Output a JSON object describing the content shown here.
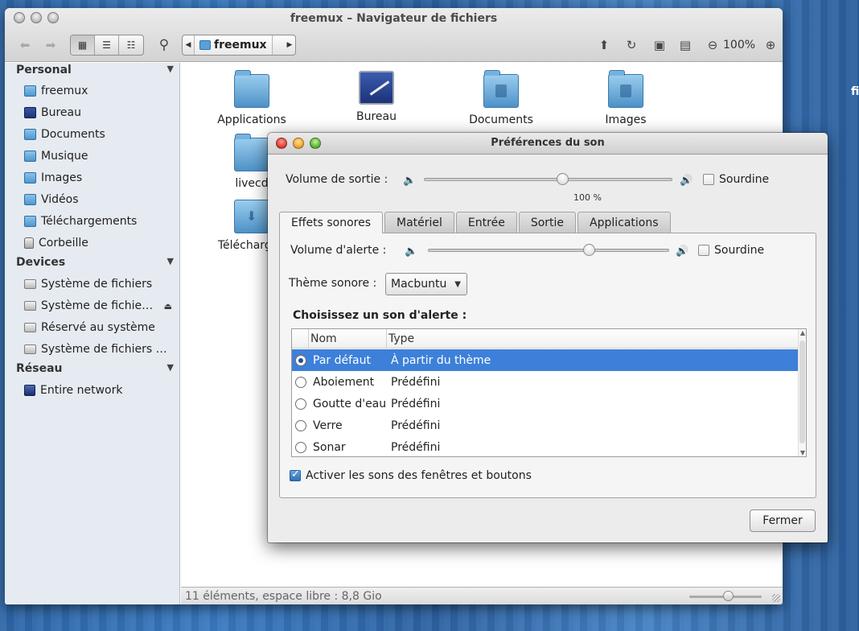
{
  "desktop": {
    "partial_label": "fi"
  },
  "file_manager": {
    "title": "freemux – Navigateur de fichiers",
    "path_crumb": "freemux",
    "zoom_label": "100%",
    "sidebar": {
      "sections": [
        {
          "header": "Personal",
          "items": [
            {
              "label": "freemux",
              "icon": "home-folder-icon"
            },
            {
              "label": "Bureau",
              "icon": "desktop-icon"
            },
            {
              "label": "Documents",
              "icon": "documents-folder-icon"
            },
            {
              "label": "Musique",
              "icon": "music-folder-icon"
            },
            {
              "label": "Images",
              "icon": "pictures-folder-icon"
            },
            {
              "label": "Vidéos",
              "icon": "videos-folder-icon"
            },
            {
              "label": "Téléchargements",
              "icon": "downloads-folder-icon"
            },
            {
              "label": "Corbeille",
              "icon": "trash-icon"
            }
          ]
        },
        {
          "header": "Devices",
          "items": [
            {
              "label": "Système de fichiers",
              "icon": "drive-icon"
            },
            {
              "label": "Système de fichie…",
              "icon": "drive-icon"
            },
            {
              "label": "Réservé au système",
              "icon": "drive-icon"
            },
            {
              "label": "Système de fichiers …",
              "icon": "drive-icon"
            }
          ]
        },
        {
          "header": "Réseau",
          "items": [
            {
              "label": "Entire network",
              "icon": "network-icon"
            }
          ]
        }
      ]
    },
    "files": [
      "Applications",
      "Bureau",
      "Documents",
      "Images",
      "livecd",
      "Téléchargen"
    ],
    "status": "11 éléments, espace libre : 8,8 Gio"
  },
  "dialog": {
    "title": "Préférences du son",
    "output_volume_label": "Volume de sortie :",
    "output_volume_percent": "100 %",
    "output_volume_level": 0.56,
    "mute_label": "Sourdine",
    "tabs": [
      "Effets sonores",
      "Matériel",
      "Entrée",
      "Sortie",
      "Applications"
    ],
    "active_tab": "Effets sonores",
    "alert_volume_label": "Volume d'alerte :",
    "alert_volume_level": 0.67,
    "alert_mute_label": "Sourdine",
    "theme_label": "Thème sonore :",
    "theme_value": "Macbuntu",
    "choose_label": "Choisissez un son d'alerte :",
    "columns": [
      "Nom",
      "Type"
    ],
    "sounds": [
      {
        "name": "Par défaut",
        "type": "À partir du thème",
        "selected": true
      },
      {
        "name": "Aboiement",
        "type": "Prédéfini",
        "selected": false
      },
      {
        "name": "Goutte d'eau",
        "type": "Prédéfini",
        "selected": false
      },
      {
        "name": "Verre",
        "type": "Prédéfini",
        "selected": false
      },
      {
        "name": "Sonar",
        "type": "Prédéfini",
        "selected": false
      }
    ],
    "enable_sounds_label": "Activer les sons des fenêtres et boutons",
    "enable_sounds_checked": true,
    "close_button": "Fermer"
  }
}
